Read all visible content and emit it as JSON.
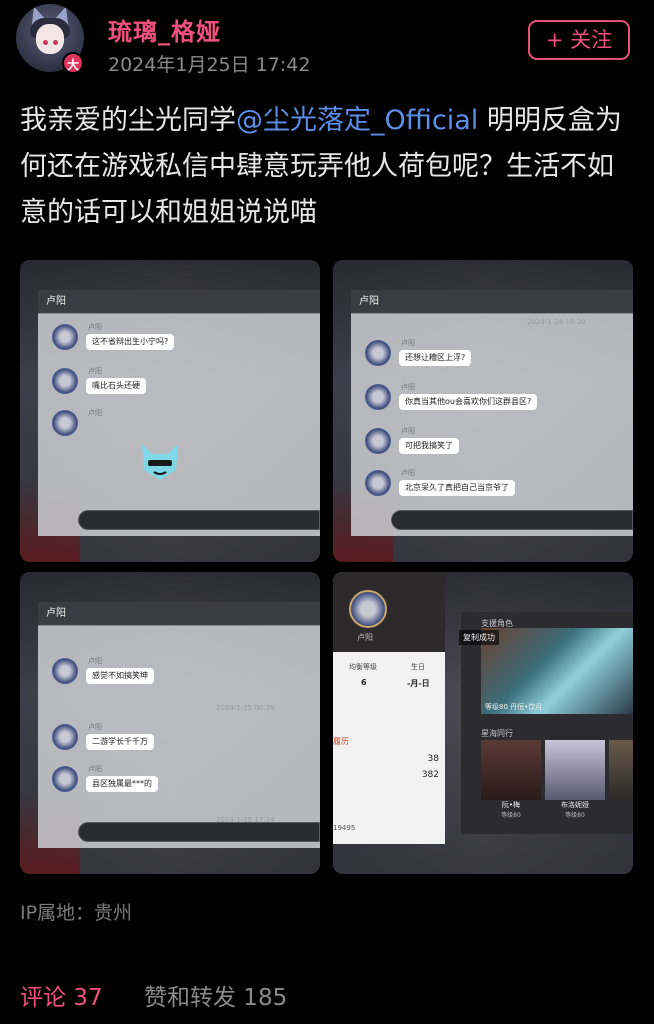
{
  "header": {
    "username": "琉璃_格娅",
    "post_time": "2024年1月25日 17:42",
    "vip_badge": "大",
    "follow_label": "+ 关注"
  },
  "post": {
    "text_before": "我亲爱的尘光同学",
    "mention": "@尘光落定_Official",
    "text_after": " 明明反盒为何还在游戏私信中肆意玩弄他人荷包呢？生活不如意的话可以和姐姐说说喵"
  },
  "images": {
    "img1": {
      "chat_title": "卢阳",
      "messages": [
        {
          "name": "卢阳",
          "text": "这不省辩出生小宁吗?"
        },
        {
          "name": "卢阳",
          "text": "嘴比石头还硬"
        },
        {
          "name": "卢阳",
          "text": ""
        }
      ]
    },
    "img2": {
      "chat_title": "卢阳",
      "timestamp": "2024-1-24 19:20",
      "messages": [
        {
          "name": "卢阳",
          "text": "还想让糟区上浮?"
        },
        {
          "name": "卢阳",
          "text": "你真当其他ou会喜欢你们这群县区?"
        },
        {
          "name": "卢阳",
          "text": "可把我搞笑了"
        },
        {
          "name": "卢阳",
          "text": "北京呆久了真把自己当京爷了"
        }
      ]
    },
    "img3": {
      "chat_title": "卢阳",
      "timestamp_1": "2024-1-25 00:28",
      "timestamp_2": "2024-1-25 17:24",
      "messages": [
        {
          "name": "卢阳",
          "text": "感觉不如搞笑坤"
        },
        {
          "name": "卢阳",
          "text": "二游学长千千万"
        },
        {
          "name": "卢阳",
          "text": "县区独属最***的"
        }
      ]
    },
    "img4": {
      "profile_name": "卢阳",
      "stats": [
        {
          "label": "均衡等级",
          "value": "6"
        },
        {
          "label": "生日",
          "value": "-月-日"
        }
      ],
      "history_label": "履历",
      "history_values": [
        "38",
        "382"
      ],
      "uid": "19495",
      "copy_toast": "复制成功",
      "support_title": "支援角色",
      "support_level": "等级80 丹恒•饮月",
      "starsea_title": "星海同行",
      "characters": [
        {
          "name": "阮•梅",
          "level": "等级80"
        },
        {
          "name": "布洛妮娅",
          "level": "等级80"
        }
      ]
    }
  },
  "footer": {
    "ip_location": "IP属地：贵州",
    "comments_label": "评论 37",
    "likes_label": "赞和转发 185"
  },
  "colors": {
    "accent": "#f0507e",
    "mention": "#5b8fe8",
    "background": "#000000"
  }
}
